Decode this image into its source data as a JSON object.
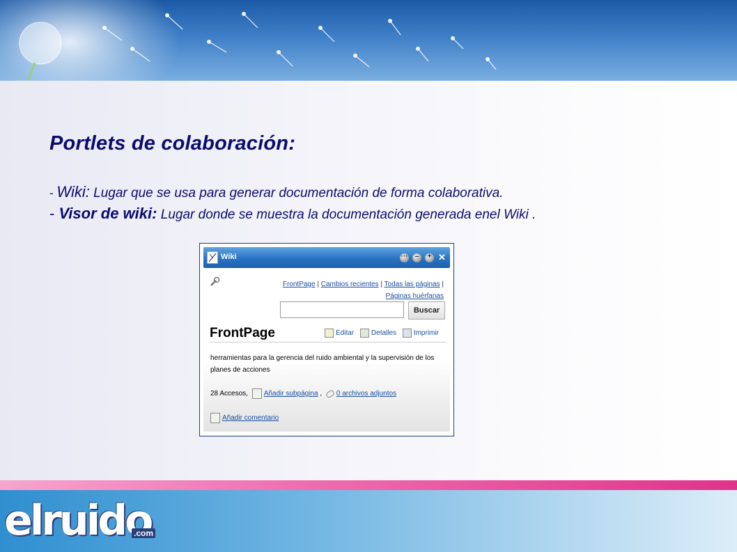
{
  "slide": {
    "title": "Portlets de colaboración:",
    "items": [
      {
        "dash": "- ",
        "term": "Wiki:",
        "desc": " Lugar que se usa para generar documentación de forma colaborativa."
      },
      {
        "dash": "- ",
        "term": "Visor de wiki:",
        "desc": " Lugar donde se muestra la documentación generada enel Wiki ."
      }
    ]
  },
  "portlet": {
    "title": "Wiki",
    "controls": [
      "options-icon",
      "minimize-icon",
      "maximize-icon",
      "close-icon"
    ],
    "close_glyph": "✕",
    "nav_links": [
      "FrontPage",
      "Cambios recientes",
      "Todas las páginas",
      "Páginas huérfanas"
    ],
    "nav_sep": "|",
    "search_button": "Buscar",
    "page_title": "FrontPage",
    "actions": {
      "edit": "Editar",
      "details": "Detalles",
      "print": "Imprimir"
    },
    "content": "herramientas para la gerencia del ruido ambiental y la supervisión de los planes de acciones",
    "accesos": "28 Accesos,",
    "add_subpage": "Añadir subpágina",
    "comma": ",",
    "attachments": "0 archivos adjuntos",
    "add_comment": "Añadir comentario"
  },
  "logo": {
    "brand": "elruido",
    "suffix": ".com"
  },
  "colors": {
    "title": "#0b0b6e",
    "link": "#1a4fa0",
    "pink": "#e0338c",
    "header_blue": "#2a73c2"
  }
}
